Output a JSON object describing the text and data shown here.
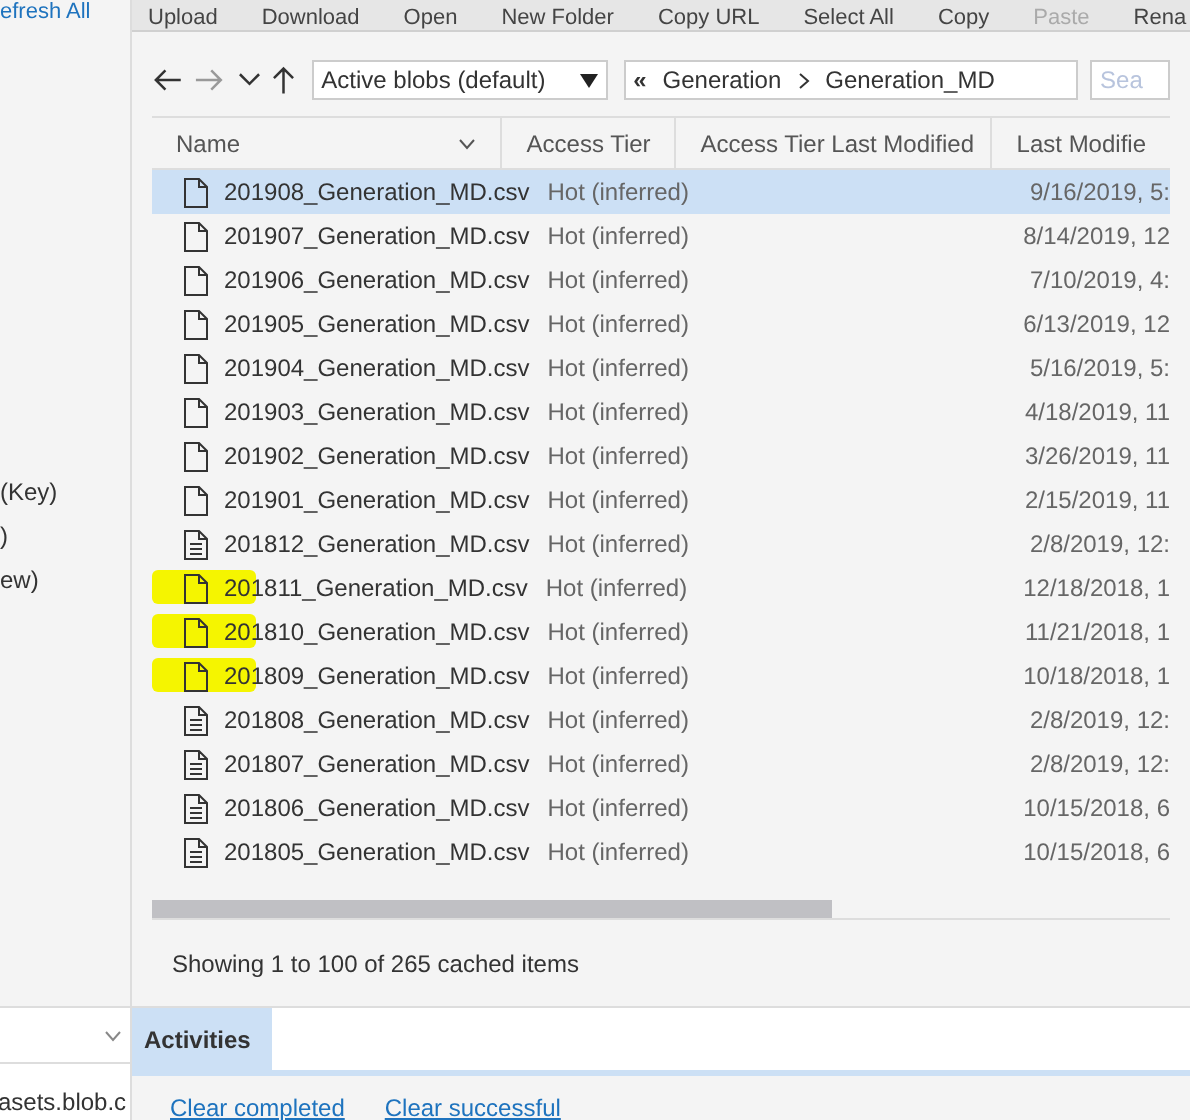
{
  "sidebar": {
    "refresh_link": "efresh All",
    "fragments": [
      "(Key)",
      ")",
      "ew)"
    ],
    "connection": "asets.blob.c"
  },
  "toolbar": {
    "buttons": [
      {
        "label": "Upload",
        "disabled": false
      },
      {
        "label": "Download",
        "disabled": false
      },
      {
        "label": "Open",
        "disabled": false
      },
      {
        "label": "New Folder",
        "disabled": false
      },
      {
        "label": "Copy URL",
        "disabled": false
      },
      {
        "label": "Select All",
        "disabled": false
      },
      {
        "label": "Copy",
        "disabled": false
      },
      {
        "label": "Paste",
        "disabled": true
      },
      {
        "label": "Rena",
        "disabled": false
      }
    ]
  },
  "nav": {
    "filter": "Active blobs (default)",
    "breadcrumb_back": "«",
    "path": [
      "Generation",
      "Generation_MD"
    ],
    "search": {
      "placeholder": "Sea"
    }
  },
  "table": {
    "columns": [
      "Name",
      "Access Tier",
      "Access Tier Last Modified",
      "Last Modifie"
    ],
    "rows": [
      {
        "name": "201908_Generation_MD.csv",
        "tier": "Hot (inferred)",
        "modified": "9/16/2019, 5:",
        "kind": "blank",
        "selected": true,
        "highlighted": false
      },
      {
        "name": "201907_Generation_MD.csv",
        "tier": "Hot (inferred)",
        "modified": "8/14/2019, 12",
        "kind": "blank",
        "selected": false,
        "highlighted": false
      },
      {
        "name": "201906_Generation_MD.csv",
        "tier": "Hot (inferred)",
        "modified": "7/10/2019, 4:",
        "kind": "blank",
        "selected": false,
        "highlighted": false
      },
      {
        "name": "201905_Generation_MD.csv",
        "tier": "Hot (inferred)",
        "modified": "6/13/2019, 12",
        "kind": "blank",
        "selected": false,
        "highlighted": false
      },
      {
        "name": "201904_Generation_MD.csv",
        "tier": "Hot (inferred)",
        "modified": "5/16/2019, 5:",
        "kind": "blank",
        "selected": false,
        "highlighted": false
      },
      {
        "name": "201903_Generation_MD.csv",
        "tier": "Hot (inferred)",
        "modified": "4/18/2019, 11",
        "kind": "blank",
        "selected": false,
        "highlighted": false
      },
      {
        "name": "201902_Generation_MD.csv",
        "tier": "Hot (inferred)",
        "modified": "3/26/2019, 11",
        "kind": "blank",
        "selected": false,
        "highlighted": false
      },
      {
        "name": "201901_Generation_MD.csv",
        "tier": "Hot (inferred)",
        "modified": "2/15/2019, 11",
        "kind": "blank",
        "selected": false,
        "highlighted": false
      },
      {
        "name": "201812_Generation_MD.csv",
        "tier": "Hot (inferred)",
        "modified": "2/8/2019, 12:",
        "kind": "text",
        "selected": false,
        "highlighted": false
      },
      {
        "name": "201811_Generation_MD.csv",
        "tier": "Hot (inferred)",
        "modified": "12/18/2018, 1",
        "kind": "blank",
        "selected": false,
        "highlighted": true
      },
      {
        "name": "201810_Generation_MD.csv",
        "tier": "Hot (inferred)",
        "modified": "11/21/2018, 1",
        "kind": "blank",
        "selected": false,
        "highlighted": true
      },
      {
        "name": "201809_Generation_MD.csv",
        "tier": "Hot (inferred)",
        "modified": "10/18/2018, 1",
        "kind": "blank",
        "selected": false,
        "highlighted": true
      },
      {
        "name": "201808_Generation_MD.csv",
        "tier": "Hot (inferred)",
        "modified": "2/8/2019, 12:",
        "kind": "text",
        "selected": false,
        "highlighted": false
      },
      {
        "name": "201807_Generation_MD.csv",
        "tier": "Hot (inferred)",
        "modified": "2/8/2019, 12:",
        "kind": "text",
        "selected": false,
        "highlighted": false
      },
      {
        "name": "201806_Generation_MD.csv",
        "tier": "Hot (inferred)",
        "modified": "10/15/2018, 6",
        "kind": "text",
        "selected": false,
        "highlighted": false
      },
      {
        "name": "201805_Generation_MD.csv",
        "tier": "Hot (inferred)",
        "modified": "10/15/2018, 6",
        "kind": "text",
        "selected": false,
        "highlighted": false
      }
    ]
  },
  "status": "Showing 1 to 100 of 265 cached items",
  "panel": {
    "tabs": [
      {
        "label": "Activities",
        "selected": true
      }
    ],
    "links": [
      "Clear completed",
      "Clear successful"
    ]
  }
}
